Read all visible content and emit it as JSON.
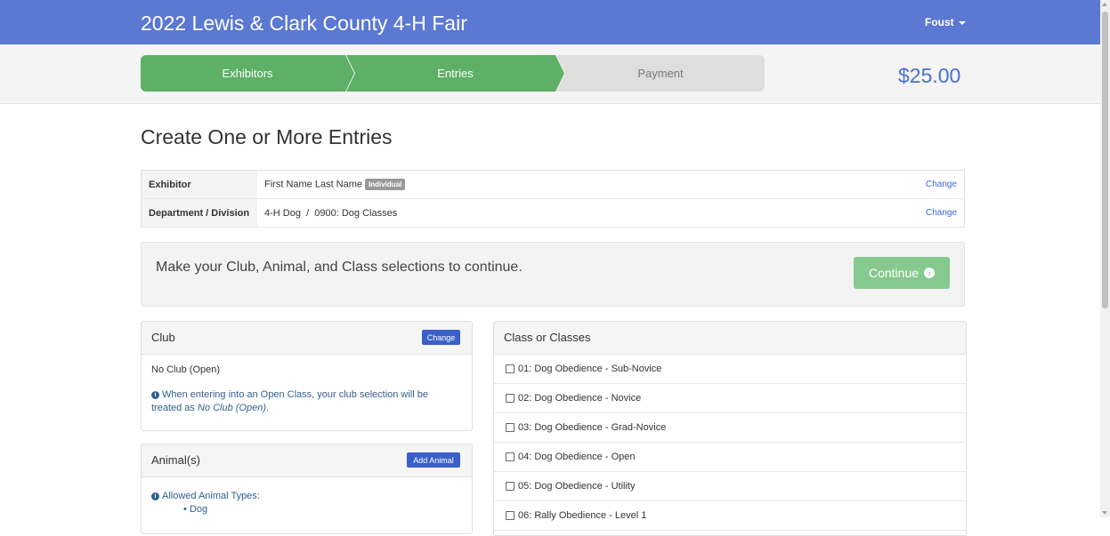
{
  "header": {
    "title": "2022 Lewis & Clark County 4-H Fair",
    "user": "Foust"
  },
  "steps": [
    {
      "label": "Exhibitors",
      "state": "complete"
    },
    {
      "label": "Entries",
      "state": "active"
    },
    {
      "label": "Payment",
      "state": "pending"
    }
  ],
  "cart_total": "$25.00",
  "page_title": "Create One or More Entries",
  "summary": {
    "exhibitor_label": "Exhibitor",
    "exhibitor_value": "First Name Last Name",
    "exhibitor_badge": "Individual",
    "department_label": "Department / Division",
    "department": "4-H Dog",
    "division": "0900: Dog Classes",
    "change_label": "Change"
  },
  "prompt": {
    "text": "Make your Club, Animal, and Class selections to continue.",
    "continue_label": "Continue"
  },
  "club": {
    "title": "Club",
    "change_label": "Change",
    "value": "No Club (Open)",
    "note_prefix": "When entering into an Open Class, your club selection will be treated as",
    "note_emphasis": "No Club (Open)",
    "note_suffix": "."
  },
  "animals": {
    "title": "Animal(s)",
    "add_label": "Add Animal",
    "allowed_label": "Allowed Animal Types:",
    "allowed_types": [
      "Dog"
    ]
  },
  "classes": {
    "title": "Class or Classes",
    "items": [
      "01: Dog Obedience - Sub-Novice",
      "02: Dog Obedience - Novice",
      "03: Dog Obedience - Grad-Novice",
      "04: Dog Obedience - Open",
      "05: Dog Obedience - Utility",
      "06: Rally Obedience - Level 1"
    ]
  },
  "colors": {
    "brand_blue": "#5b78d3",
    "step_green": "#5db066",
    "button_blue": "#3b5fc8",
    "continue_green": "#86c98f"
  }
}
